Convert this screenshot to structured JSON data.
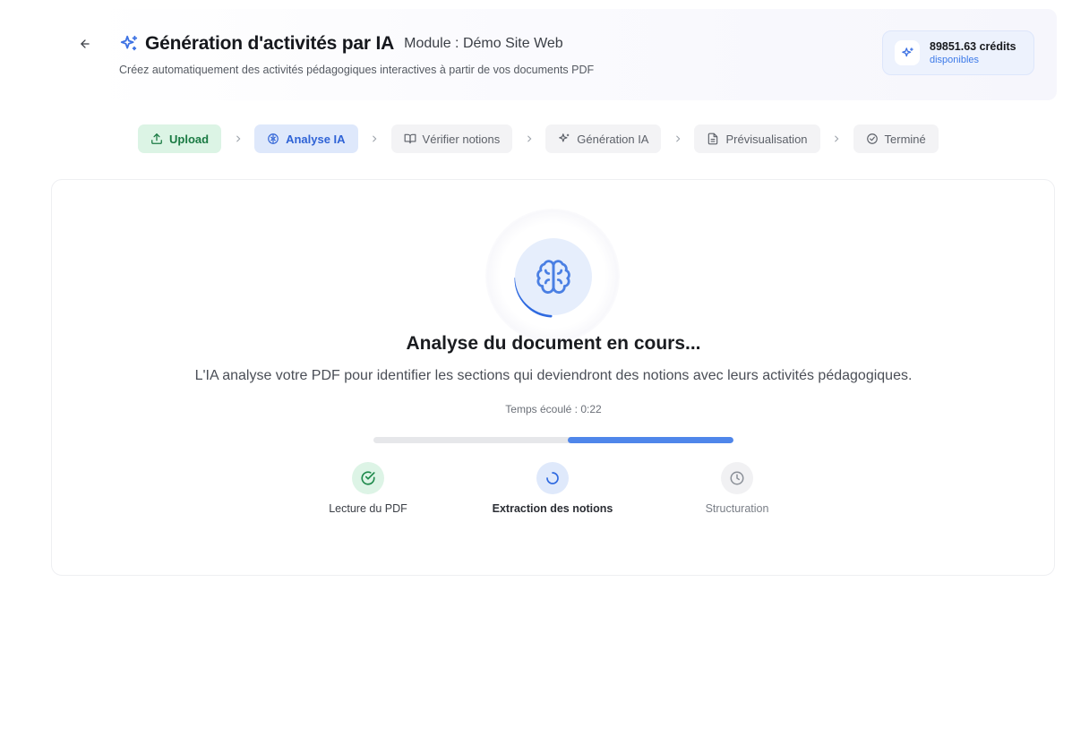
{
  "header": {
    "title": "Génération d'activités par IA",
    "module": "Module : Démo Site Web",
    "subtitle": "Créez automatiquement des activités pédagogiques interactives à partir de vos documents PDF",
    "back_icon": "arrow-left-icon",
    "title_icon": "sparkles-icon"
  },
  "credits": {
    "amount": "89851.63 crédits",
    "label": "disponibles",
    "icon": "sparkles-icon"
  },
  "steps": [
    {
      "label": "Upload",
      "state": "done",
      "icon": "upload-icon"
    },
    {
      "label": "Analyse IA",
      "state": "active",
      "icon": "brain-icon"
    },
    {
      "label": "Vérifier notions",
      "state": "pending",
      "icon": "book-open-icon"
    },
    {
      "label": "Génération IA",
      "state": "pending",
      "icon": "sparkles-icon"
    },
    {
      "label": "Prévisualisation",
      "state": "pending",
      "icon": "file-text-icon"
    },
    {
      "label": "Terminé",
      "state": "pending",
      "icon": "check-circle-icon"
    }
  ],
  "analysis": {
    "heading": "Analyse du document en cours...",
    "description": "L'IA analyse votre PDF pour identifier les sections qui deviendront des notions avec leurs activités pédagogiques.",
    "elapsed": "Temps écoulé : 0:22",
    "progress": {
      "start": 0.54,
      "end": 1.0
    },
    "substeps": [
      {
        "label": "Lecture du PDF",
        "state": "done",
        "icon": "check-circle-icon"
      },
      {
        "label": "Extraction des notions",
        "state": "active",
        "icon": "loader-icon"
      },
      {
        "label": "Structuration",
        "state": "pending",
        "icon": "clock-icon"
      }
    ]
  },
  "colors": {
    "accent": "#4f86ea",
    "success": "#1a7a43",
    "active_bg": "#dee8fb",
    "done_bg": "#dcf4e5"
  }
}
